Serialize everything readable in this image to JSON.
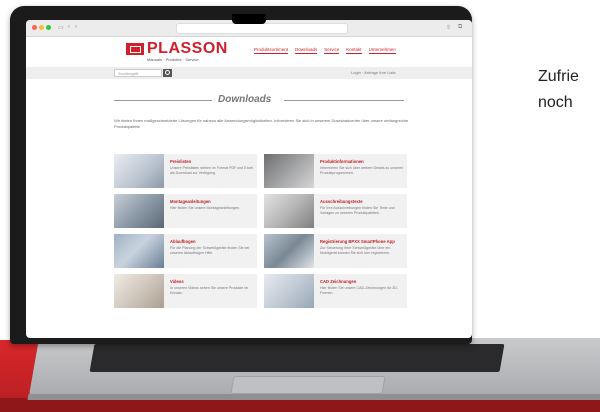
{
  "caption_lines": [
    "Zufrie",
    "noch"
  ],
  "site": {
    "brand": "PLASSON",
    "brand_sub": "Manuals · Produkte · Service",
    "nav": [
      "Produktsortiment",
      "Downloads",
      "Service",
      "Kontakt",
      "Unternehmen"
    ],
    "search_placeholder": "Suchbegriff",
    "cart_text": "Login · Anfrage Ihre Liste",
    "downloads_heading": "Downloads",
    "intro_text": "Wir bieten Ihnen maßgeschneiderte Lösungen für nahezu alle Anwendungsmöglichkeiten. Informieren Sie sich in unserem Downloadcenter über unsere umfangreiche Produktpalette.",
    "tiles": [
      {
        "title": "Preislisten",
        "desc": "Unsere Preislisten stehen im Format PDF und Excel als Download zur Verfügung."
      },
      {
        "title": "Produktinformationen",
        "desc": "Informieren Sie sich über weitere Details zu unseren Produktprogrammen."
      },
      {
        "title": "Montageanleitungen",
        "desc": "Hier finden Sie unsere Montageanleitungen."
      },
      {
        "title": "Ausschreibungstexte",
        "desc": "Für Ihre Ausschreibungen finden Sie Texte und Vorlagen zu unseren Produktpaletten."
      },
      {
        "title": "Ablaufbogen",
        "desc": "Für die Planung der Schweißgeräte finden Sie bei unseren Ablaufbögen Hilfe."
      },
      {
        "title": "Registrierung BPXX SmartPhone App",
        "desc": "Zur Steuerung Ihrer Schweißgeräte über ein Mobilgerät können Sie sich hier registrieren."
      },
      {
        "title": "Videos",
        "desc": "In unseren Videos sehen Sie unsere Produkte im Einsatz."
      },
      {
        "title": "CAD Zeichnungen",
        "desc": "Hier finden Sie unsere CAD-Zeichnungen für 3D-Formen."
      }
    ]
  },
  "colors": {
    "brand_red": "#d0202a",
    "desk_red": "#c9272c",
    "laptop_frame": "#1b1b1c"
  }
}
